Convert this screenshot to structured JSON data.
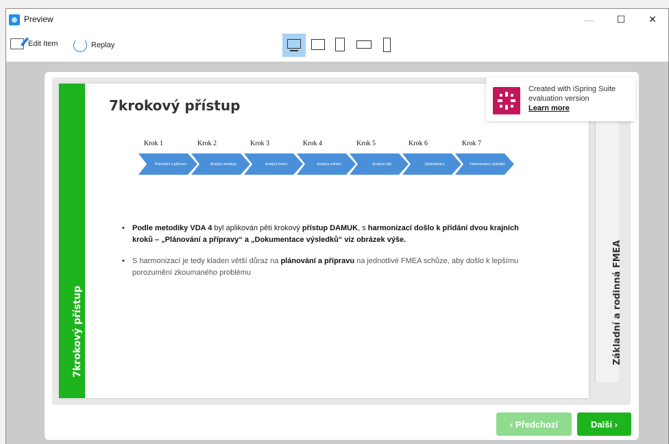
{
  "window": {
    "title": "Preview",
    "minimize": "—",
    "maximize": "☐",
    "close": "✕"
  },
  "toolbar": {
    "edit_label": "Edit Item",
    "replay_label": "Replay",
    "devices": [
      "desktop",
      "tablet-landscape",
      "tablet-portrait",
      "phone-landscape",
      "phone-portrait"
    ],
    "active_device": "desktop"
  },
  "slide": {
    "title": "7krokový přístup",
    "left_band": "7krokový přístup",
    "right_band": "Základní a rodinná FMEA",
    "steps": [
      {
        "label": "Krok 1",
        "text": "Plánování a příprava"
      },
      {
        "label": "Krok 2",
        "text": "Analýza struktury"
      },
      {
        "label": "Krok 3",
        "text": "Analýza funkcí"
      },
      {
        "label": "Krok 4",
        "text": "Analýza selhání"
      },
      {
        "label": "Krok 5",
        "text": "Analýza rizik"
      },
      {
        "label": "Krok 6",
        "text": "Optimalizace"
      },
      {
        "label": "Krok 7",
        "text": "Dokumentace výsledků"
      }
    ],
    "bullet1": {
      "p1": "Podle metodiky VDA 4",
      "p2": " byl aplikován pěti krokový ",
      "p3": "přístup DAMUK",
      "p4": ", s ",
      "p5": "harmonizací došlo k přidání dvou krajních kroků – „Plánování a přípravy“ a „Dokumentace výsledků“ viz obrázek výše."
    },
    "bullet2": {
      "p1": "S harmonizací je tedy kladen větší důraz na ",
      "p2": "plánování a přípravu",
      "p3": " na jednotlivé FMEA schůze, aby došlo k lepšímu porozumění zkoumaného problému"
    }
  },
  "ispring": {
    "line1": "Created with iSpring Suite",
    "line2": "evaluation version",
    "link": "Learn more"
  },
  "nav": {
    "prev": "‹ Předchozí",
    "next": "Další ›"
  },
  "colors": {
    "accent_green": "#1db41d",
    "accent_green_disabled": "#8fdc8f",
    "chevron_blue": "#4a90d9",
    "ispring_magenta": "#c2185b"
  }
}
